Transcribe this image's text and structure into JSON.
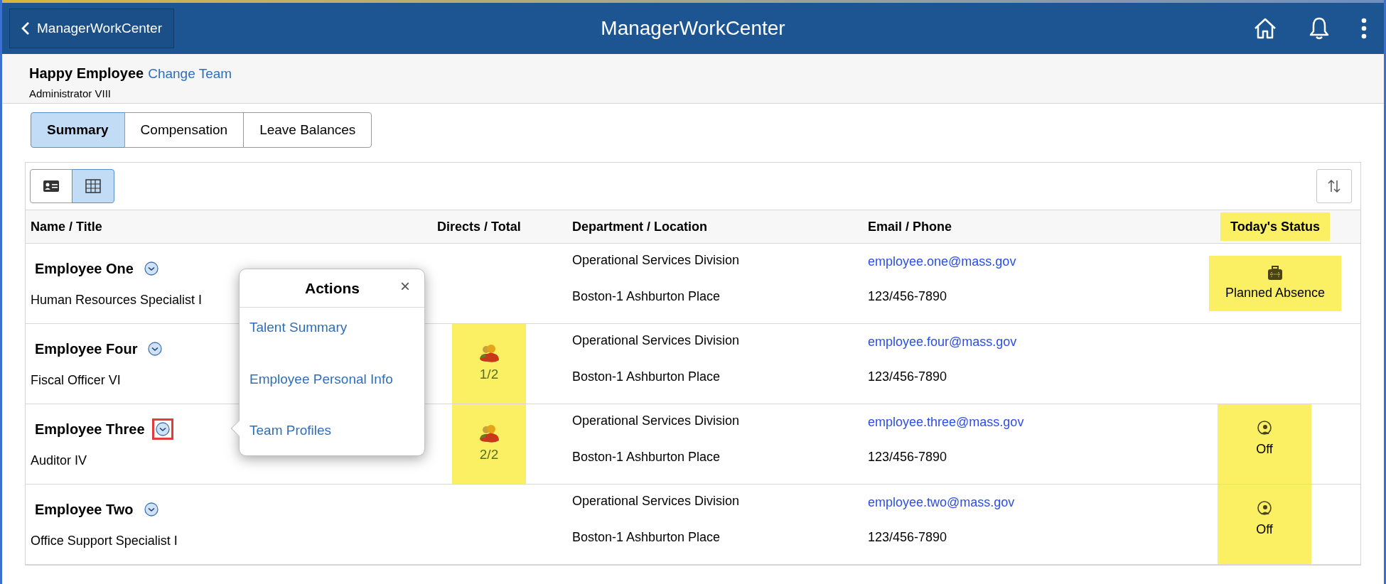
{
  "header": {
    "back_label": "ManagerWorkCenter",
    "title": "ManagerWorkCenter"
  },
  "manager": {
    "name": "Happy Employee",
    "change_link": "Change Team",
    "title": "Administrator VIII"
  },
  "tabs": [
    {
      "label": "Summary",
      "selected": true
    },
    {
      "label": "Compensation",
      "selected": false
    },
    {
      "label": "Leave Balances",
      "selected": false
    }
  ],
  "view_toggle": [
    {
      "kind": "card",
      "selected": false
    },
    {
      "kind": "grid",
      "selected": true
    }
  ],
  "table": {
    "columns": [
      {
        "label": "Name / Title",
        "highlighted": false
      },
      {
        "label": "Directs / Total",
        "highlighted": false
      },
      {
        "label": "Department / Location",
        "highlighted": false
      },
      {
        "label": "Email / Phone",
        "highlighted": false
      },
      {
        "label": "Today's Status",
        "highlighted": true
      }
    ],
    "rows": [
      {
        "name": "Employee One",
        "title": "Human Resources Specialist I",
        "menu_outlined": false,
        "directs": null,
        "department": "Operational Services Division",
        "location": "Boston-1 Ashburton Place",
        "email": "employee.one@mass.gov",
        "phone": "123/456-7890",
        "status": {
          "kind": "absence",
          "text": "Planned Absence",
          "highlighted": true
        }
      },
      {
        "name": "Employee Four",
        "title": "Fiscal Officer VI",
        "menu_outlined": false,
        "directs": {
          "text": "1/2",
          "highlighted": true
        },
        "department": "Operational Services Division",
        "location": "Boston-1 Ashburton Place",
        "email": "employee.four@mass.gov",
        "phone": "123/456-7890",
        "status": null
      },
      {
        "name": "Employee Three",
        "title": "Auditor IV",
        "menu_outlined": true,
        "directs": {
          "text": "2/2",
          "highlighted": true
        },
        "department": "Operational Services Division",
        "location": "Boston-1 Ashburton Place",
        "email": "employee.three@mass.gov",
        "phone": "123/456-7890",
        "status": {
          "kind": "off",
          "text": "Off",
          "highlighted": true
        }
      },
      {
        "name": "Employee Two",
        "title": "Office Support Specialist I",
        "menu_outlined": false,
        "directs": null,
        "department": "Operational Services Division",
        "location": "Boston-1 Ashburton Place",
        "email": "employee.two@mass.gov",
        "phone": "123/456-7890",
        "status": {
          "kind": "off",
          "text": "Off",
          "highlighted": true
        }
      }
    ]
  },
  "actions_popup": {
    "title": "Actions",
    "close": "×",
    "items": [
      "Talent Summary",
      "Employee Personal Info",
      "Team Profiles"
    ]
  }
}
